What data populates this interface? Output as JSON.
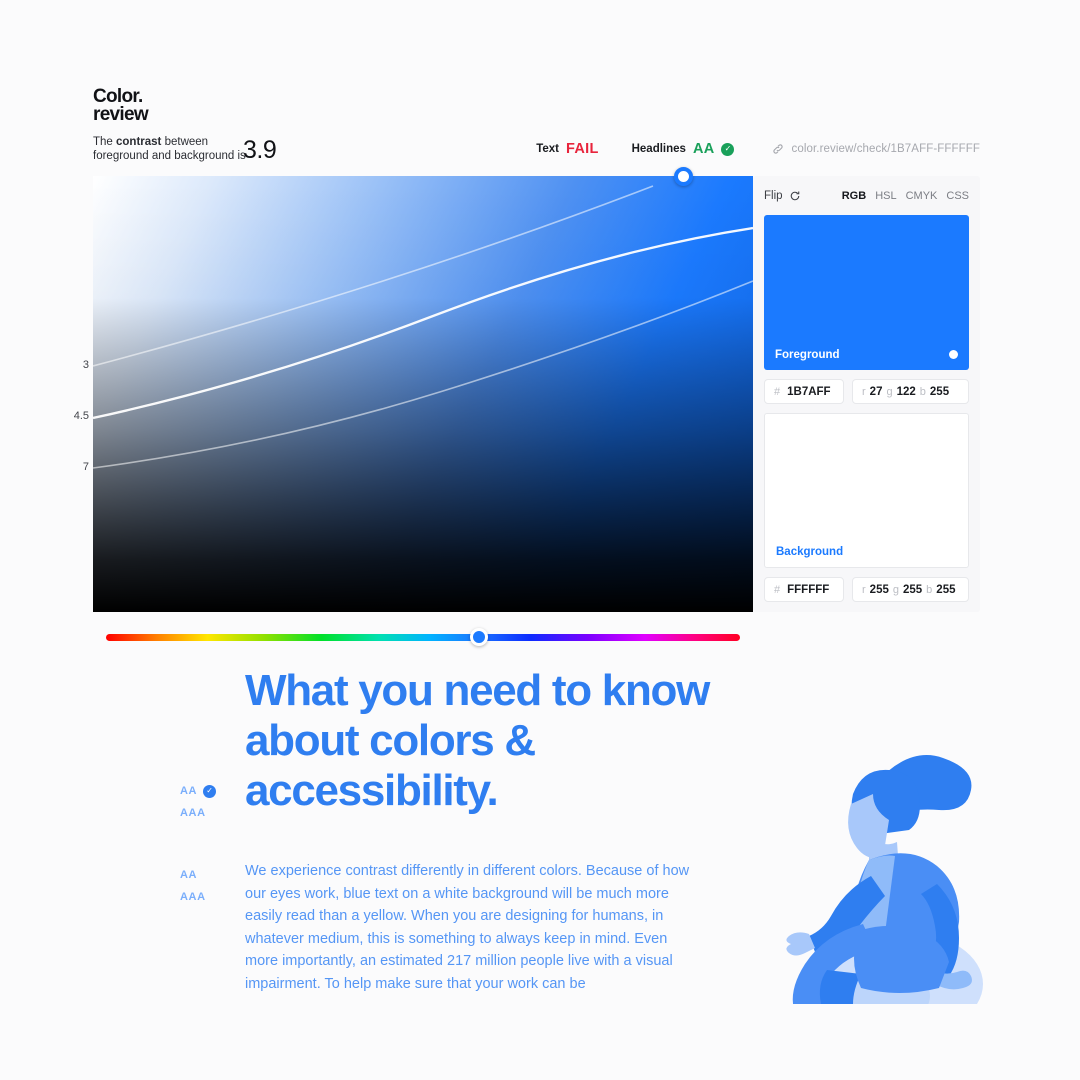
{
  "brand": {
    "line1": "Color.",
    "line2": "review"
  },
  "contrast": {
    "label_prefix": "The ",
    "label_bold": "contrast",
    "label_suffix": " between",
    "label_line2": "foreground and background is",
    "score": "3.9"
  },
  "judgements": [
    {
      "name": "Text",
      "value": "FAIL",
      "status": "fail",
      "has_check": false
    },
    {
      "name": "Headlines",
      "value": "AA",
      "status": "pass",
      "has_check": true
    }
  ],
  "url": {
    "icon": "link-icon",
    "text": "color.review/check/1B7AFF-FFFFFF"
  },
  "panel": {
    "flip_label": "Flip",
    "flip_icon": "rotate-icon",
    "modes": [
      {
        "label": "RGB",
        "active": true
      },
      {
        "label": "HSL",
        "active": false
      },
      {
        "label": "CMYK",
        "active": false
      },
      {
        "label": "CSS",
        "active": false
      }
    ],
    "foreground": {
      "label": "Foreground",
      "color": "#1B7AFF",
      "hex_key": "#",
      "hex_value": "1B7AFF",
      "r_key": "r",
      "r_value": "27",
      "g_key": "g",
      "g_value": "122",
      "b_key": "b",
      "b_value": "255"
    },
    "background": {
      "label": "Background",
      "color": "#FFFFFF",
      "hex_key": "#",
      "hex_value": "FFFFFF",
      "r_key": "r",
      "r_value": "255",
      "g_key": "g",
      "g_value": "255",
      "b_key": "b",
      "b_value": "255"
    }
  },
  "chart_data": {
    "type": "line",
    "title": "",
    "xlabel": "",
    "ylabel": "",
    "grid": false,
    "legend": "none",
    "description": "Contrast-ratio iso-curves over a hue/lightness gradient field",
    "yticks": [
      {
        "label": "3",
        "pos_pct": 43.5
      },
      {
        "label": "4.5",
        "pos_pct": 55.5
      },
      {
        "label": "7",
        "pos_pct": 67.0
      }
    ],
    "series": [
      {
        "name": "3",
        "points": [
          [
            0,
            43.5
          ],
          [
            20,
            36
          ],
          [
            40,
            27
          ],
          [
            58,
            17
          ],
          [
            72,
            8
          ],
          [
            82,
            2
          ]
        ]
      },
      {
        "name": "4.5",
        "points": [
          [
            0,
            55.5
          ],
          [
            18,
            50
          ],
          [
            38,
            42
          ],
          [
            58,
            31
          ],
          [
            78,
            20
          ],
          [
            100,
            12
          ]
        ]
      },
      {
        "name": "7",
        "points": [
          [
            0,
            67
          ],
          [
            20,
            63
          ],
          [
            40,
            57
          ],
          [
            60,
            48
          ],
          [
            80,
            36
          ],
          [
            100,
            24
          ]
        ]
      }
    ],
    "handle": {
      "x_pct": 89.5,
      "y_pct": 0,
      "color": "#1B7AFF"
    }
  },
  "hue_slider": {
    "value_pct": 59,
    "handle_color": "#1B7AFF"
  },
  "article": {
    "headline": "What you need to know about colors & accessibility.",
    "headline_badges": [
      {
        "label": "AA",
        "has_check": true
      },
      {
        "label": "AAA",
        "has_check": false
      }
    ],
    "body_badges": [
      {
        "label": "AA",
        "has_check": false
      },
      {
        "label": "AAA",
        "has_check": false
      }
    ],
    "paragraph": "We experience contrast differently in different colors. Because of how our eyes work, blue text on a white background will be much more easily read than a yellow. When you are designing for humans, in whatever medium, this is something to always keep in mind. Even more importantly, an estimated 217 million people live with a visual impairment. To help make sure that your work can be",
    "illustration_name": "seated-person-illustration"
  },
  "colors": {
    "accent": "#1B7AFF",
    "headline": "#2F7EF0",
    "body": "#5596F5",
    "fail": "#E8243C",
    "pass": "#19A05A"
  }
}
